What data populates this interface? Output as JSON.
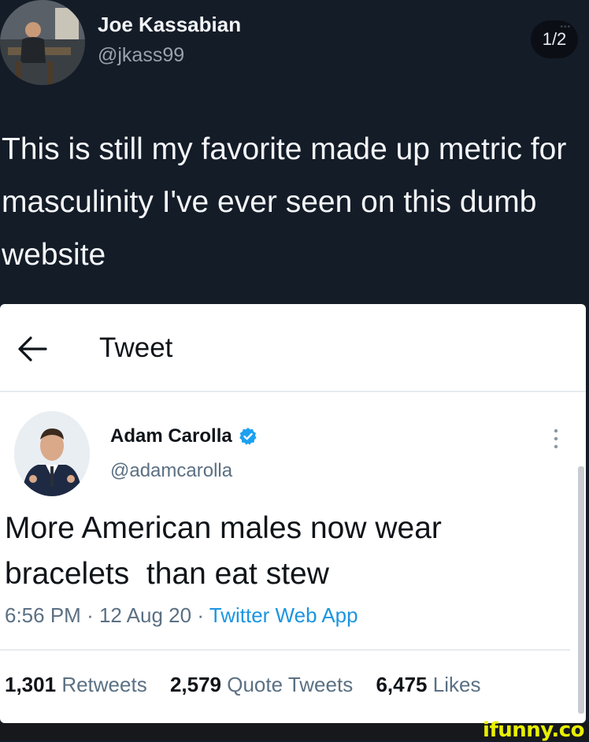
{
  "outer_tweet": {
    "name": "Joe Kassabian",
    "handle": "@jkass99",
    "page_indicator": "1/2",
    "text": "This is still my favorite made up metric for masculinity I've ever seen on this dumb website"
  },
  "embedded_tweet": {
    "header_title": "Tweet",
    "name": "Adam Carolla",
    "verified": true,
    "handle": "@adamcarolla",
    "text_line1": "More American males now wear",
    "text_line2": "bracelets  than eat stew",
    "time": "6:56 PM",
    "date": "12 Aug 20",
    "source": "Twitter Web App",
    "separator": "·",
    "retweets_count": "1,301",
    "retweets_label": "Retweets",
    "quote_count": "2,579",
    "quote_label": "Quote Tweets",
    "likes_count": "6,475",
    "likes_label": "Likes"
  },
  "watermark": "ifunny.co",
  "colors": {
    "outer_background": "#141c28",
    "card_background": "#ffffff",
    "link_blue": "#1b95e0",
    "verified_blue": "#1da1f2",
    "watermark_yellow": "#e8f000"
  }
}
